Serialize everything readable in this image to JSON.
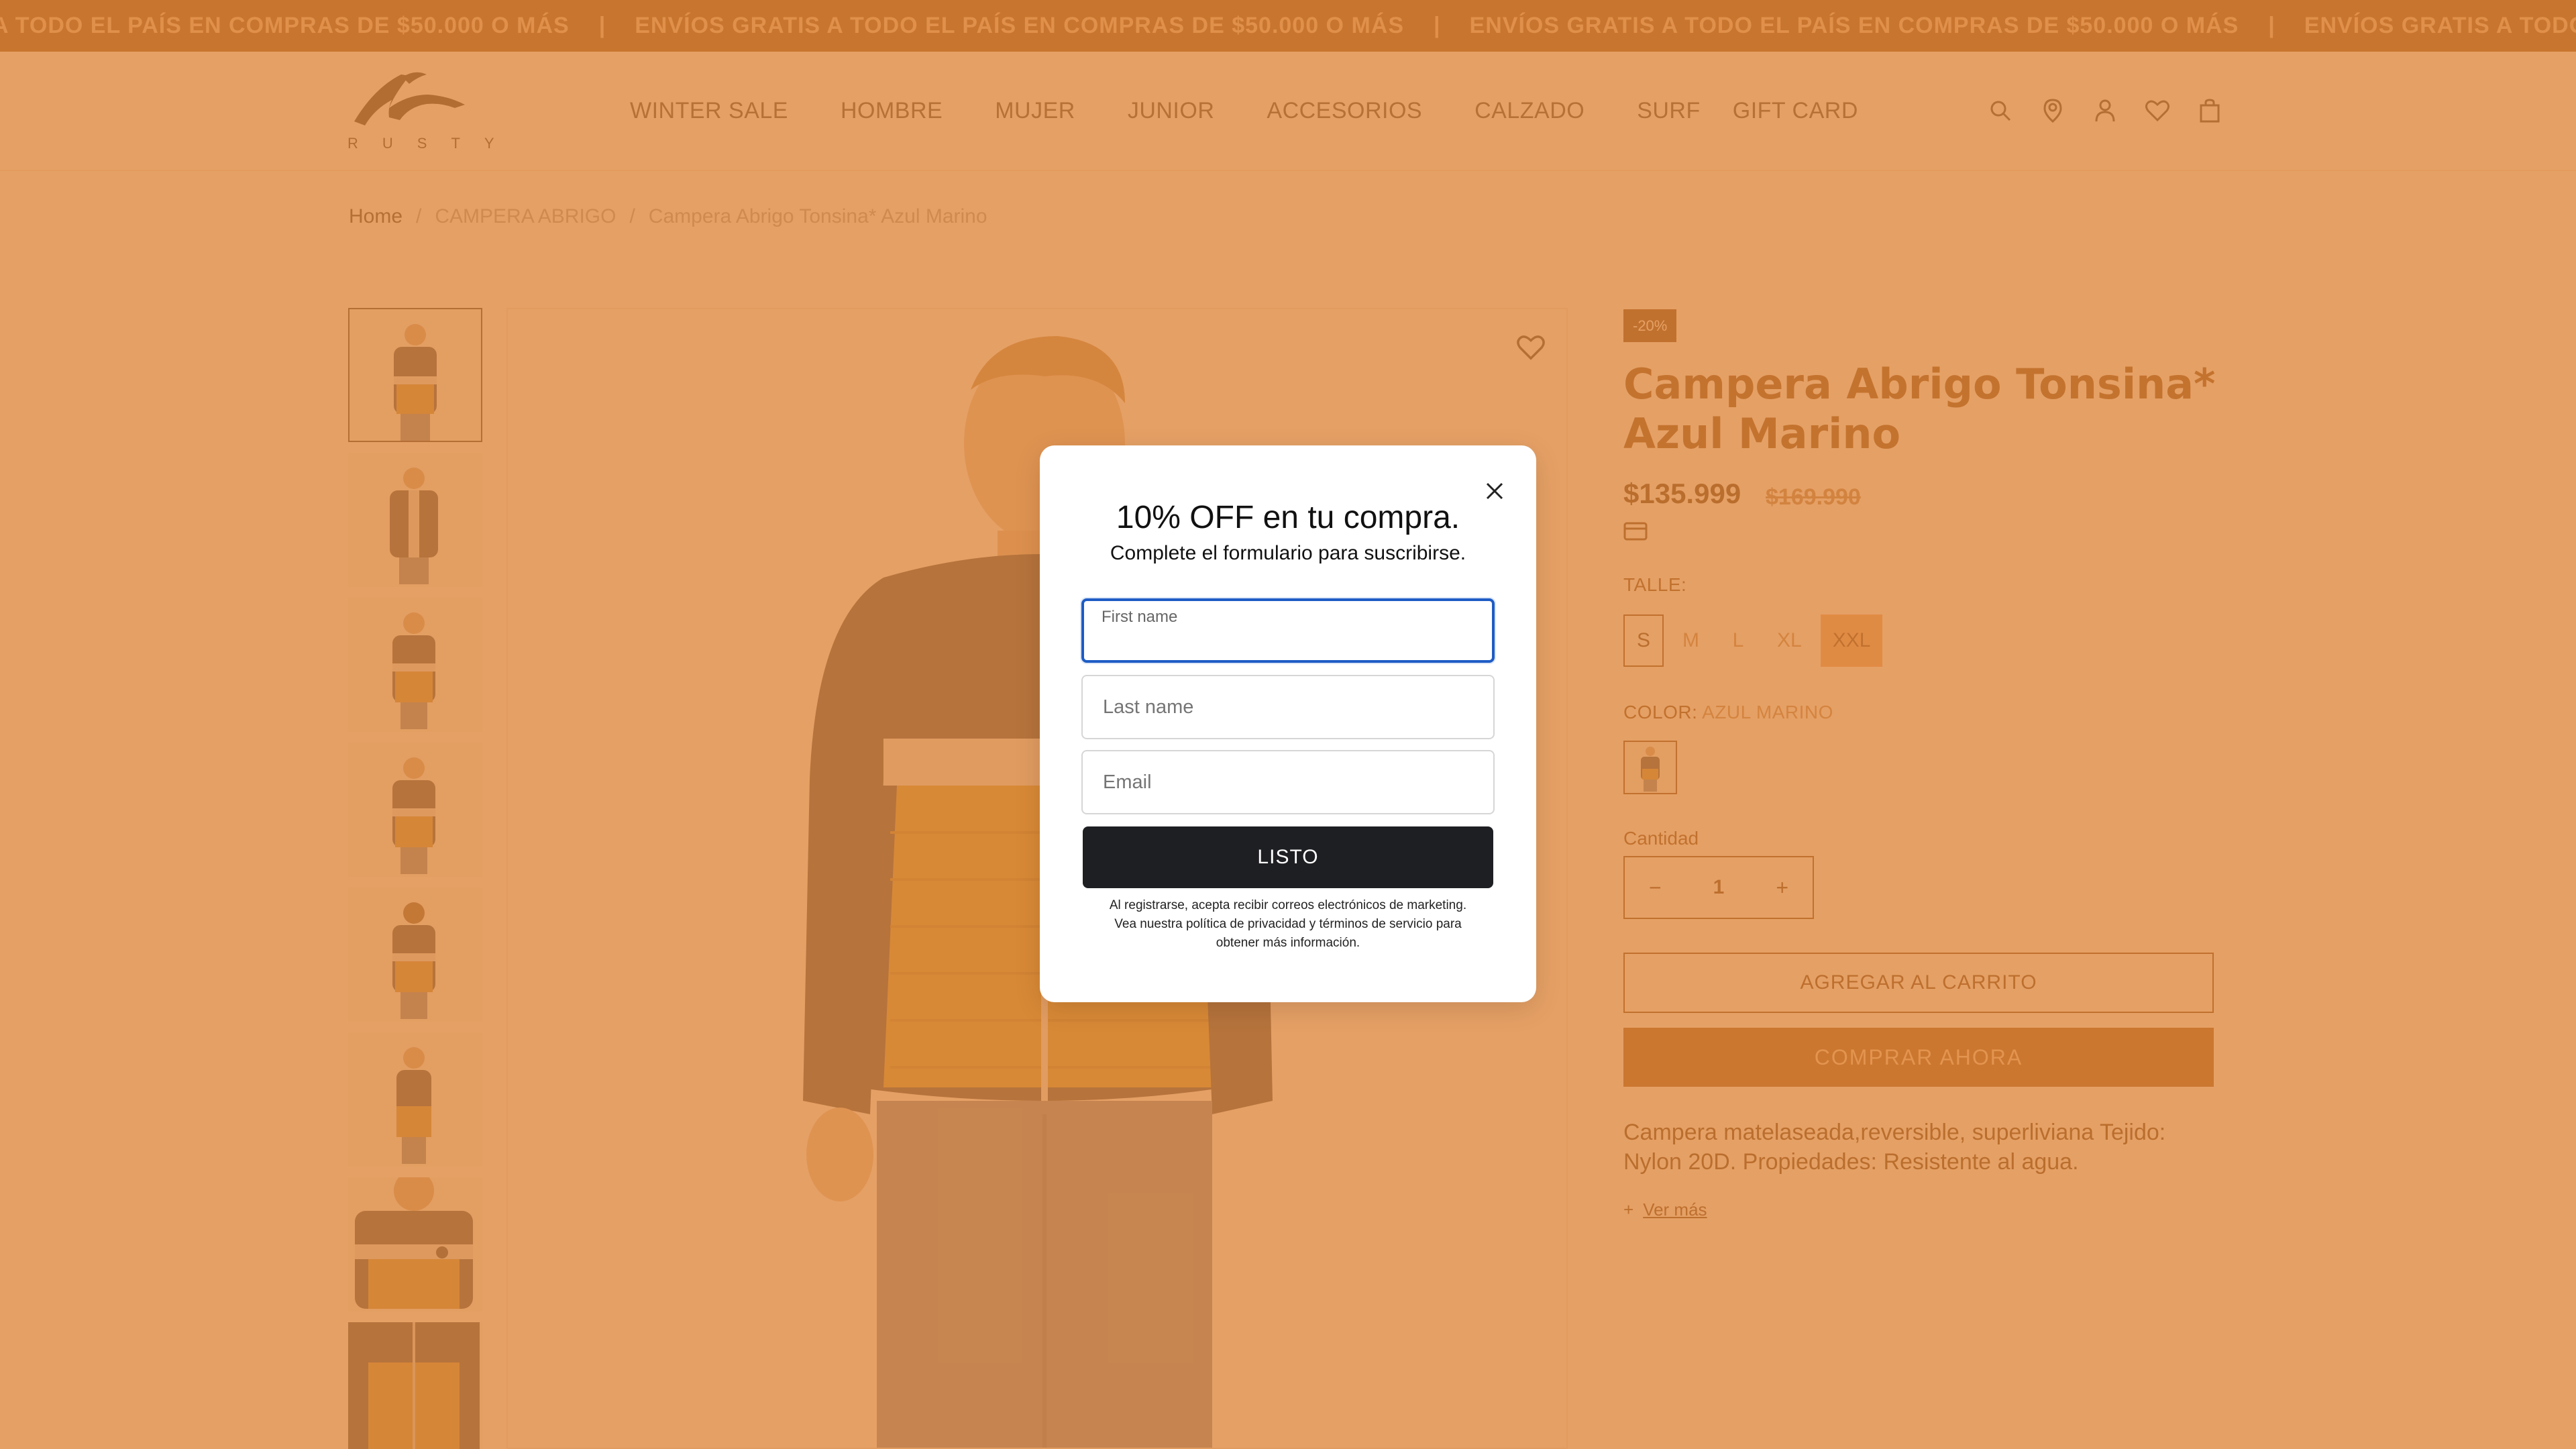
{
  "announcement": {
    "items": [
      "A TODO EL PAÍS EN COMPRAS DE $50.000 O MÁS",
      "ENVÍOS GRATIS A TODO EL PAÍS EN COMPRAS DE $50.000 O MÁS",
      "ENVÍOS GRATIS A TODO EL PAÍS EN COMPRAS DE $50.000 O MÁS",
      "ENVÍOS GRATIS A TODO"
    ],
    "separator": "|"
  },
  "logo": {
    "text": "RUSTY"
  },
  "nav": {
    "items": [
      "WINTER SALE",
      "HOMBRE",
      "MUJER",
      "JUNIOR",
      "ACCESORIOS",
      "CALZADO",
      "SURF",
      "GIFT CARD"
    ]
  },
  "header_icons": [
    "search-icon",
    "account-login-icon",
    "user-icon",
    "heart-icon",
    "bag-icon"
  ],
  "breadcrumb": {
    "home": "Home",
    "sep": "/",
    "category": "CAMPERA ABRIGO",
    "current": "Campera Abrigo Tonsina* Azul Marino"
  },
  "gallery": {
    "thumb_count": 8
  },
  "product": {
    "badge": "-20%",
    "title": "Campera Abrigo Tonsina* Azul Marino",
    "price": "$135.999",
    "old_price": "$169.990",
    "size_label": "TALLE:",
    "sizes": [
      "S",
      "M",
      "L",
      "XL",
      "XXL"
    ],
    "color_label": "COLOR:",
    "color_value": "AZUL MARINO",
    "quantity_label": "Cantidad",
    "quantity": "1",
    "minus": "−",
    "plus": "+",
    "add_to_cart": "AGREGAR AL CARRITO",
    "buy_now": "COMPRAR AHORA",
    "description": "Campera matelaseada,reversible, superliviana Tejido: Nylon 20D. Propiedades: Resistente al agua.",
    "more": "Ver más"
  },
  "modal": {
    "title": "10% OFF en tu compra.",
    "subtitle": "Complete el formulario para suscribirse.",
    "first_name": "First name",
    "last_name_placeholder": "Last name",
    "email_placeholder": "Email",
    "submit": "LISTO",
    "legal": "Al registrarse, acepta recibir correos electrónicos de marketing. Vea nuestra política de privacidad y términos de servicio para obtener más información."
  },
  "colors": {
    "overlay": "#de853a",
    "brand_dark": "#7a3d0a",
    "button_dark": "#1e1f23",
    "focus_blue": "#1e5cc5"
  }
}
